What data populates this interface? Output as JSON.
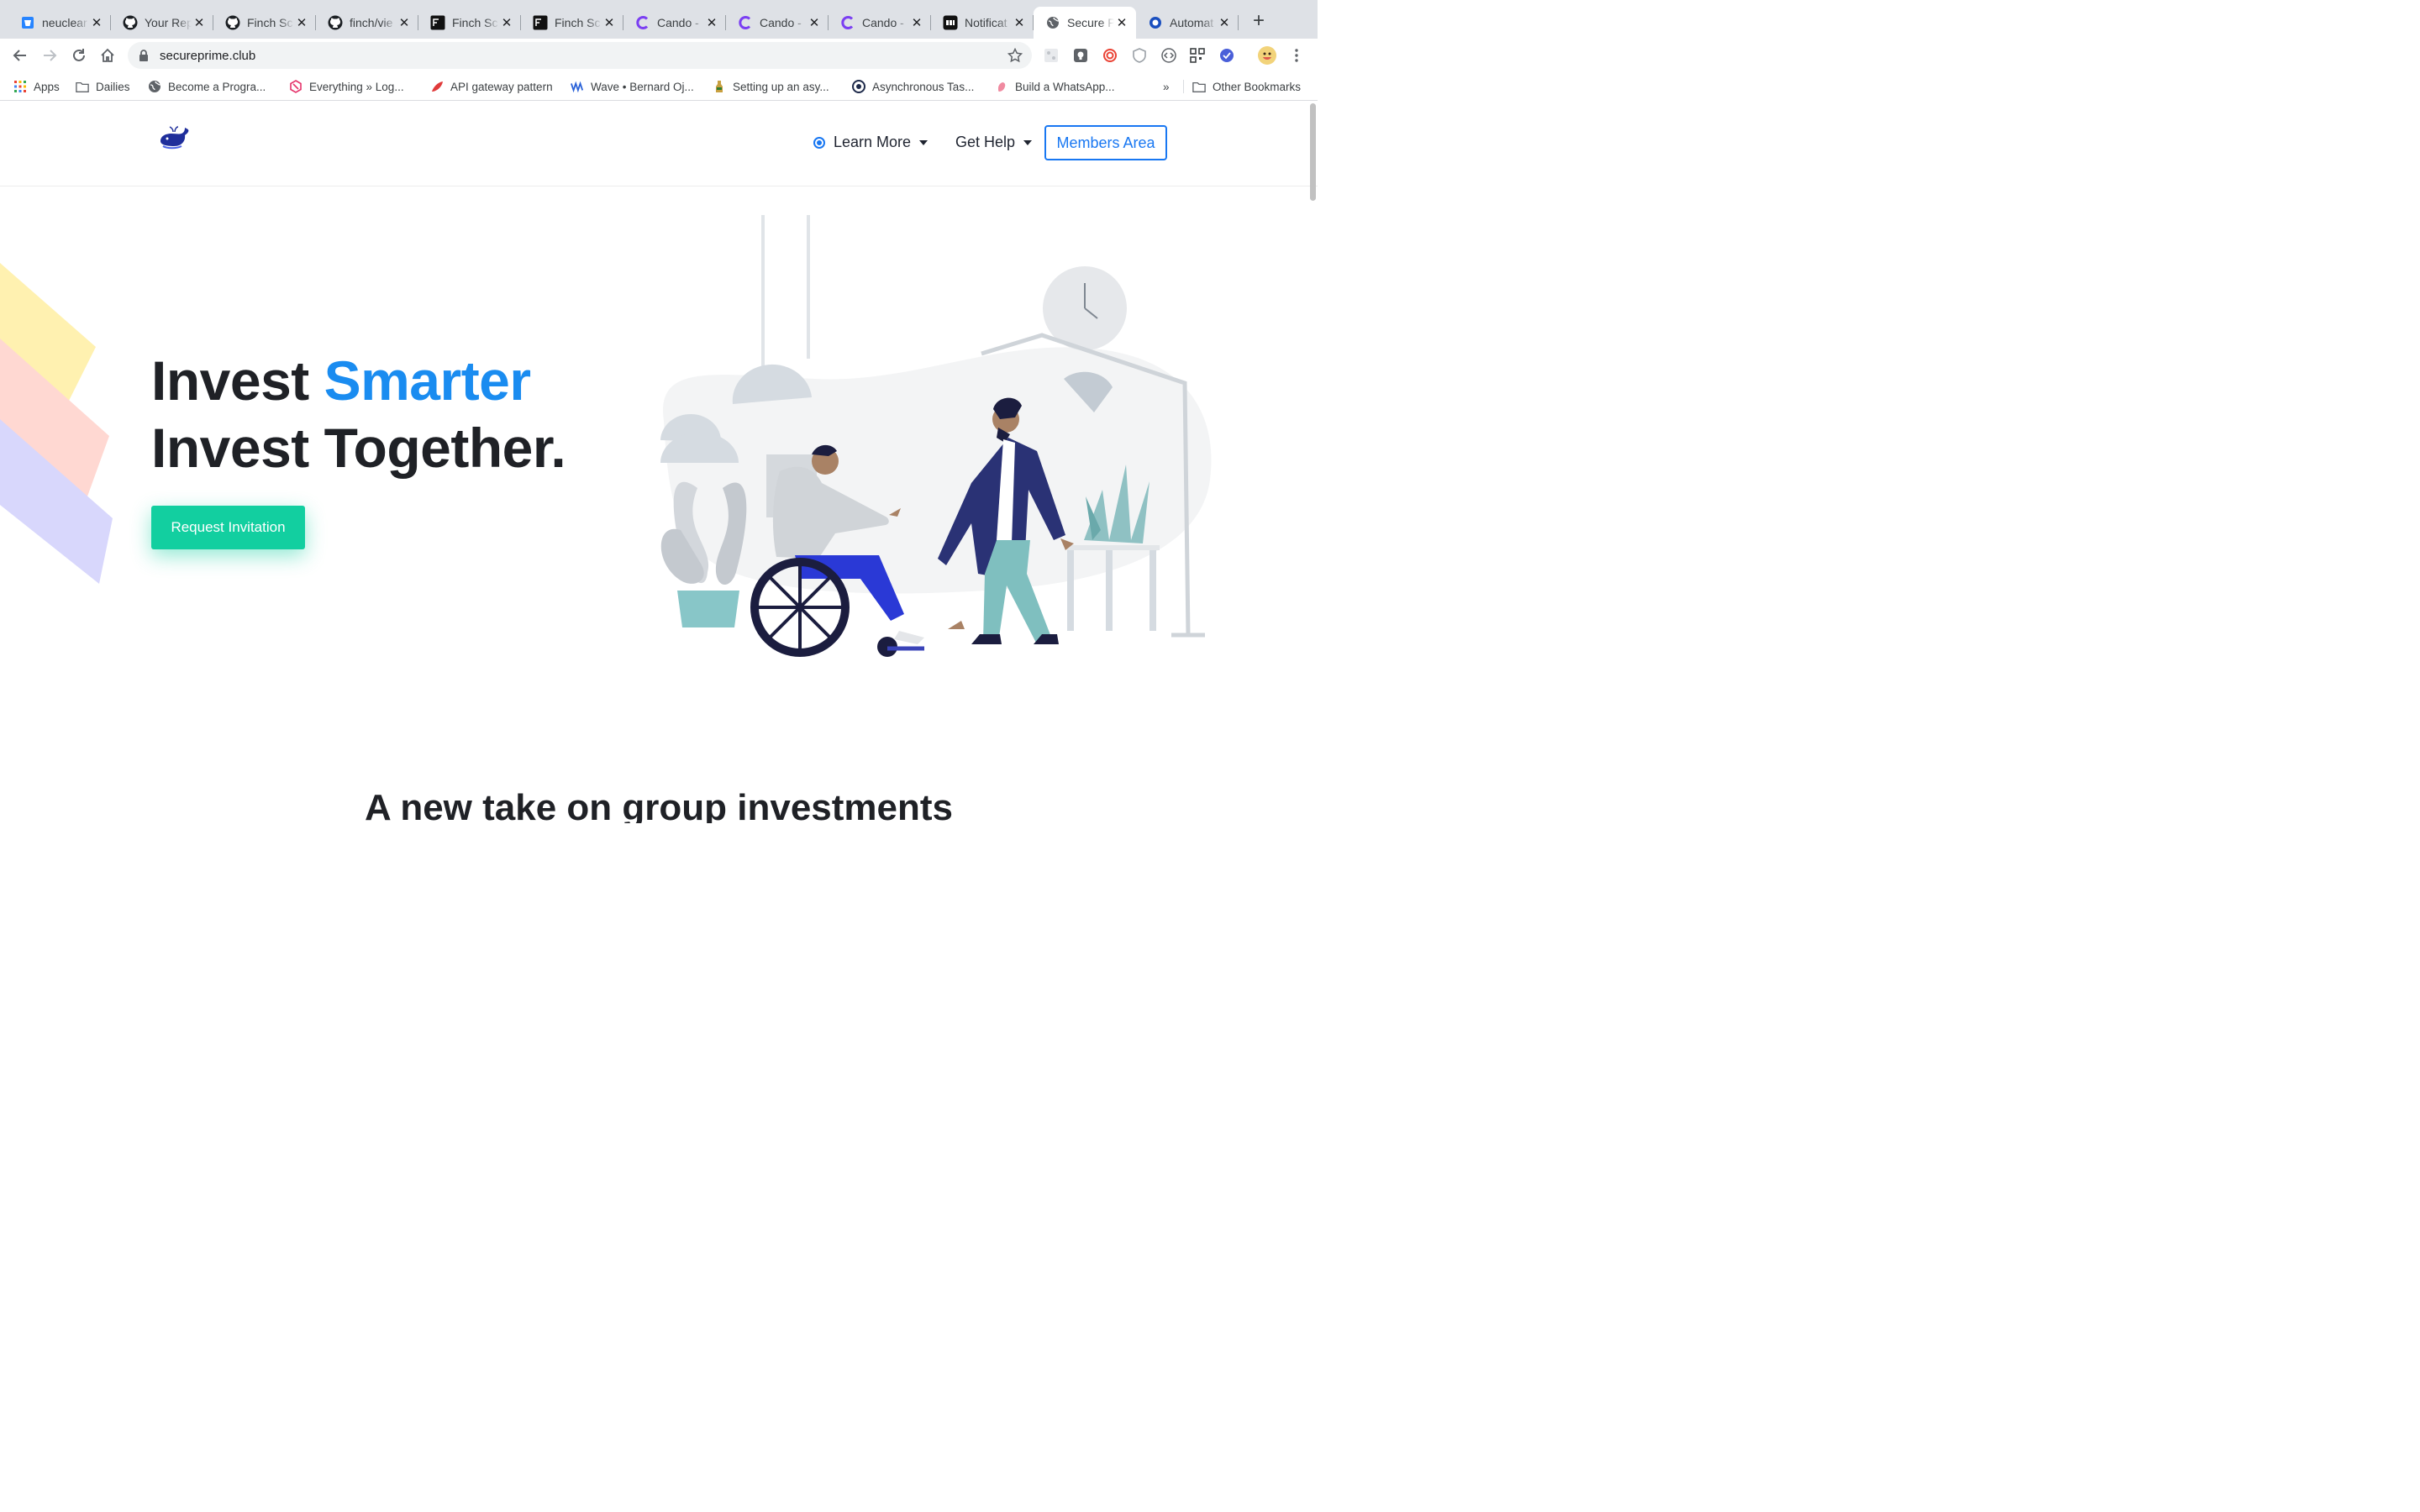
{
  "browser": {
    "tabs": [
      {
        "title": "neuclear",
        "icon": "bitbucket-icon"
      },
      {
        "title": "Your Repositories",
        "icon": "github-icon"
      },
      {
        "title": "Finch Sc",
        "icon": "github-icon"
      },
      {
        "title": "finch/vie",
        "icon": "github-icon"
      },
      {
        "title": "Finch Sc",
        "icon": "finch-icon"
      },
      {
        "title": "Finch Sc",
        "icon": "finch-icon"
      },
      {
        "title": "Cando -",
        "icon": "cando-icon"
      },
      {
        "title": "Cando -",
        "icon": "cando-icon"
      },
      {
        "title": "Cando -",
        "icon": "cando-icon"
      },
      {
        "title": "Notificat",
        "icon": "notification-icon"
      },
      {
        "title": "Secure P",
        "icon": "globe-icon",
        "active": true
      },
      {
        "title": "Automat",
        "icon": "automation-icon"
      }
    ],
    "close_glyph": "✕",
    "new_tab_glyph": "+",
    "url": "secureprime.club",
    "bookmarks": [
      {
        "label": "Apps",
        "icon": "apps-grid-icon"
      },
      {
        "label": "Dailies",
        "icon": "folder-icon"
      },
      {
        "label": "Become a Progra...",
        "icon": "globe-icon"
      },
      {
        "label": "Everything » Log...",
        "icon": "log-icon"
      },
      {
        "label": "API gateway pattern",
        "icon": "feather-icon"
      },
      {
        "label": "Wave • Bernard Oj...",
        "icon": "wave-icon"
      },
      {
        "label": "Setting up an asy...",
        "icon": "bottle-icon"
      },
      {
        "label": "Asynchronous Tas...",
        "icon": "python-icon"
      },
      {
        "label": "Build a WhatsApp...",
        "icon": "hand-icon"
      }
    ],
    "more_bookmarks": "»",
    "other_bookmarks": "Other Bookmarks"
  },
  "site": {
    "nav": {
      "learn_more": "Learn More",
      "get_help": "Get Help",
      "members_area": "Members Area"
    },
    "hero": {
      "line1_a": "Invest ",
      "line1_b": "Smarter",
      "line2": "Invest Together.",
      "cta": "Request Invitation"
    },
    "section_heading": "A new take on group investments"
  },
  "colors": {
    "accent": "#1a8cf0",
    "cta": "#12cfa0",
    "nav_border": "#1877f2",
    "heading": "#1f2126"
  }
}
